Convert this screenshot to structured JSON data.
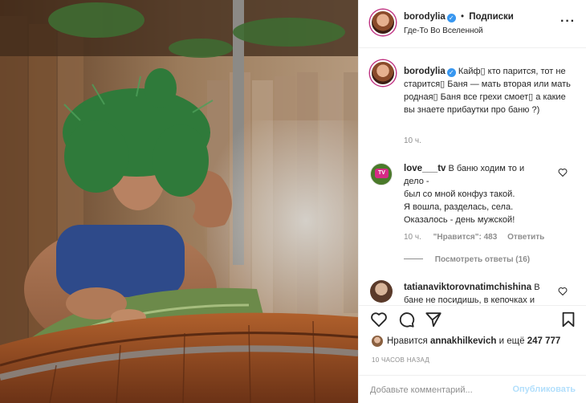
{
  "header": {
    "username": "borodylia",
    "dot": "•",
    "follow_label": "Подписки",
    "location": "Где-То Во Вселенной",
    "more_icon": "more-horizontal-icon"
  },
  "caption": {
    "username": "borodylia",
    "text": "Кайф\u0000 кто парится, тот не старится\u0000 Баня — мать вторая или мать родная\u0000 Баня все грехи смоет\u0000 а какие вы знаете прибаутки про баню ?)",
    "time": "10 ч."
  },
  "comment": {
    "username": "love___tv",
    "lines": [
      "В баню ходим то и",
      "дело -",
      "был со мной конфуз такой.",
      "Я вошла, разделась, села.",
      "Оказалось - день мужской!"
    ],
    "time": "10 ч.",
    "likes": "\"Нравится\": 483",
    "reply": "Ответить",
    "view_replies": "Посмотреть ответы (16)"
  },
  "comment2": {
    "username": "tatianaviktorovnatimchishina",
    "text_visible": "В",
    "cut_line": "бане не посидишь, в кепочках и"
  },
  "actions": {
    "icons": [
      "heart-icon",
      "comment-icon",
      "share-icon",
      "bookmark-icon"
    ],
    "likes_prefix": "Нравится",
    "likes_user": "annakhilkevich",
    "likes_mid": "и ещё",
    "likes_count": "247 777",
    "time": "10 ЧАСОВ НАЗАД"
  },
  "add_comment": {
    "placeholder": "Добавьте комментарий...",
    "publish": "Опубликовать"
  },
  "colors": {
    "accent": "#3897f0",
    "publish_disabled": "#b2dffc",
    "muted": "#8e8e8e"
  }
}
